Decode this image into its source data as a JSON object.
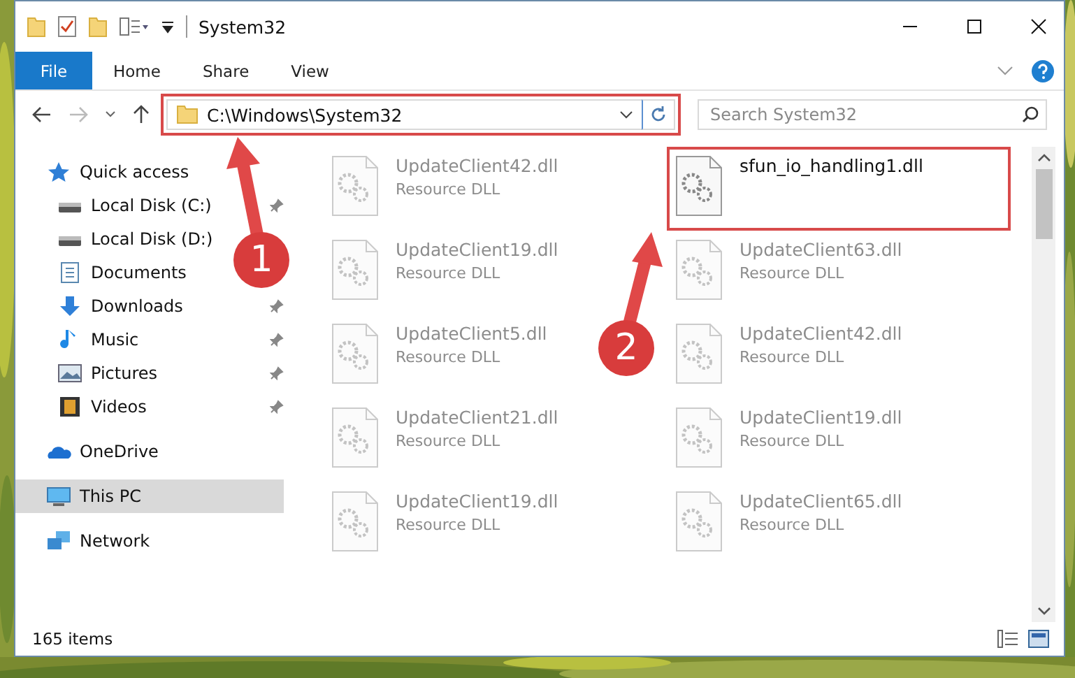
{
  "window": {
    "title": "System32"
  },
  "ribbon": {
    "tabs": [
      {
        "label": "File",
        "selected": true
      },
      {
        "label": "Home",
        "selected": false
      },
      {
        "label": "Share",
        "selected": false
      },
      {
        "label": "View",
        "selected": false
      }
    ]
  },
  "address_bar": {
    "path": "C:\\Windows\\System32",
    "highlighted": true
  },
  "search": {
    "placeholder": "Search System32"
  },
  "sidebar": {
    "items": [
      {
        "label": "Quick access",
        "kind": "star",
        "selected": false,
        "children": [
          {
            "label": "Local Disk (C:)",
            "kind": "drive",
            "pinned": true,
            "selected": false
          },
          {
            "label": "Local Disk (D:)",
            "kind": "drive",
            "pinned": false,
            "selected": false
          },
          {
            "label": "Documents",
            "kind": "document",
            "pinned": false,
            "selected": false
          },
          {
            "label": "Downloads",
            "kind": "download",
            "pinned": true,
            "selected": false
          },
          {
            "label": "Music",
            "kind": "music",
            "pinned": true,
            "selected": false
          },
          {
            "label": "Pictures",
            "kind": "picture",
            "pinned": true,
            "selected": false
          },
          {
            "label": "Videos",
            "kind": "video",
            "pinned": true,
            "selected": false
          }
        ]
      },
      {
        "label": "OneDrive",
        "kind": "cloud",
        "selected": false
      },
      {
        "label": "This PC",
        "kind": "computer",
        "selected": true
      },
      {
        "label": "Network",
        "kind": "network",
        "selected": false
      }
    ]
  },
  "files": [
    {
      "name": "UpdateClient42.dll",
      "type": "Resource DLL",
      "faded": true,
      "highlighted": false
    },
    {
      "name": "sfun_io_handling1.dll",
      "faded": false,
      "highlighted": true
    },
    {
      "name": "UpdateClient19.dll",
      "type": "Resource DLL",
      "faded": true,
      "highlighted": false
    },
    {
      "name": "UpdateClient63.dll",
      "type": "Resource DLL",
      "faded": true,
      "highlighted": false
    },
    {
      "name": "UpdateClient5.dll",
      "type": "Resource DLL",
      "faded": true,
      "highlighted": false
    },
    {
      "name": "UpdateClient42.dll",
      "type": "Resource DLL",
      "faded": true,
      "highlighted": false
    },
    {
      "name": "UpdateClient21.dll",
      "type": "Resource DLL",
      "faded": true,
      "highlighted": false
    },
    {
      "name": "UpdateClient19.dll",
      "type": "Resource DLL",
      "faded": true,
      "highlighted": false
    },
    {
      "name": "UpdateClient19.dll",
      "type": "Resource DLL",
      "faded": true,
      "highlighted": false
    },
    {
      "name": "UpdateClient65.dll",
      "type": "Resource DLL",
      "faded": true,
      "highlighted": false
    }
  ],
  "status_bar": {
    "item_count": "165 items"
  },
  "callouts": [
    {
      "number": "1"
    },
    {
      "number": "2"
    }
  ]
}
